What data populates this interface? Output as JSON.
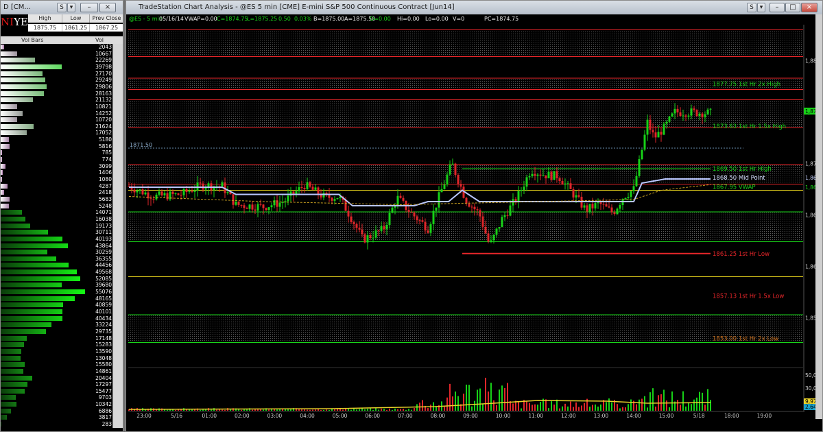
{
  "left_window": {
    "title": "D [CM...",
    "logo_top": "NI",
    "logo_bottom": "YER",
    "header_cells": [
      "High",
      "Low",
      "Prev Close"
    ],
    "header_values": [
      "1875.75",
      "1861.25",
      "1867.25"
    ],
    "vol_bars_label": "Vol Bars",
    "vol_label": "Vol",
    "ladder_volumes": [
      "2043",
      "10667",
      "22269",
      "39798",
      "27170",
      "29249",
      "29806",
      "28163",
      "21132",
      "10821",
      "14252",
      "10720",
      "21624",
      "17052",
      "5180",
      "5816",
      "785",
      "774",
      "3099",
      "1406",
      "1080",
      "4287",
      "2418",
      "5683",
      "5248",
      "14071",
      "16038",
      "19173",
      "30711",
      "40193",
      "43864",
      "30259",
      "36355",
      "44456",
      "49568",
      "52085",
      "39680",
      "55076",
      "48165",
      "40859",
      "40101",
      "40434",
      "33224",
      "29735",
      "17148",
      "15283",
      "13590",
      "13048",
      "15580",
      "14861",
      "20404",
      "17297",
      "15477",
      "9703",
      "10342",
      "6886",
      "3817",
      "283"
    ],
    "toolbar_s": "S",
    "toolbar_dropdown": "▾"
  },
  "chart_window": {
    "title": "TradeStation Chart Analysis - @ES 5 min [CME] E-mini S&P 500 Continuous Contract [Jun14]",
    "status": {
      "symbol": "@ES - 5 min",
      "date": "05/16/14",
      "vwap": "VWAP=0.00",
      "close": "C=1874.75",
      "low": "L=1875.25",
      "change": "0.50",
      "pct": "0.03%",
      "bid": "B=1875.00",
      "ask": "A=1875.50",
      "o": "O=0.00",
      "hi": "Hi=0.00",
      "lo": "Lo=0.00",
      "v": "V=0",
      "pc": "PC=1874.75"
    },
    "dotted_line_label": "1871.50",
    "last_price_tag": "1,875.2",
    "price_axis_labels": [
      "1,880.00",
      "1,875.00",
      "1,870.00",
      "1,868.5",
      "1,867.9",
      "1,865.00",
      "1,860.00",
      "1,855.00"
    ],
    "volume_axis_labels": [
      "50,000",
      "30,000",
      "9,976",
      "2,642"
    ],
    "level_labels": [
      {
        "text": "1877.75 1st Hr  2x High",
        "color": "#19d419"
      },
      {
        "text": "1873.63 1st Hr  1.5x High",
        "color": "#19d419"
      },
      {
        "text": "1869.50 1st Hr  High",
        "color": "#19d419"
      },
      {
        "text": "1868.50 Mid Point",
        "color": "#d6e0ff"
      },
      {
        "text": "1867.95 VWAP",
        "color": "#19d419"
      },
      {
        "text": "1861.25 1st Hr  Low",
        "color": "#e8262a"
      },
      {
        "text": "1857.13 1st Hr  1.5x Low",
        "color": "#e8262a"
      },
      {
        "text": "1853.00 1st Hr  2x Low",
        "color": "#c87020"
      }
    ],
    "time_labels": [
      "23:00",
      "5/16",
      "01:00",
      "02:00",
      "03:00",
      "04:00",
      "05:00",
      "06:00",
      "07:00",
      "08:00",
      "09:00",
      "10:00",
      "11:00",
      "12:00",
      "13:00",
      "14:00",
      "15:00",
      "5/18",
      "18:00",
      "19:00"
    ],
    "toolbar_s": "S"
  },
  "chart_data": {
    "type": "candlestick",
    "title": "",
    "xlabel": "",
    "ylabel": "",
    "ylim": [
      1850.5,
      1883.5
    ],
    "grid": false,
    "levels": [
      1877.75,
      1873.63,
      1869.5,
      1868.5,
      1867.95,
      1861.25,
      1857.13,
      1853.0
    ],
    "candles": [],
    "volume_ylim": [
      0,
      60000
    ]
  },
  "colors": {
    "up": "#17d117",
    "down": "#e0262a",
    "zone_line_red": "#e8262a",
    "zone_line_green": "#19d419",
    "yellow": "#d8c51a",
    "midpoint": "#b9c6ff"
  }
}
